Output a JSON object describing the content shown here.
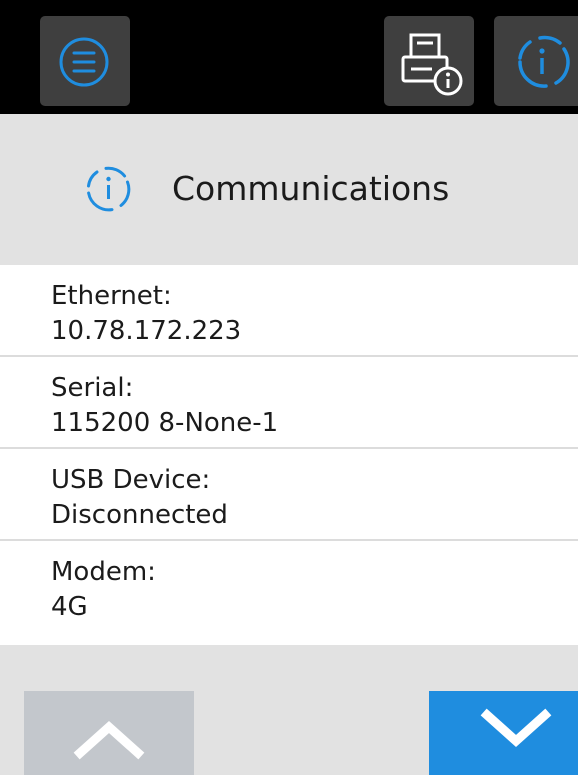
{
  "header": {
    "title": "Communications",
    "icon": "info-icon",
    "accent": "#1f8ddf"
  },
  "topbar": {
    "buttons": [
      {
        "name": "menu",
        "icon": "menu-icon"
      },
      {
        "name": "printer-info",
        "icon": "printer-info-icon"
      },
      {
        "name": "info",
        "icon": "info-icon",
        "active": true
      }
    ]
  },
  "items": [
    {
      "label": "Ethernet:",
      "value": "10.78.172.223"
    },
    {
      "label": "Serial:",
      "value": "115200 8-None-1"
    },
    {
      "label": "USB Device:",
      "value": "Disconnected"
    },
    {
      "label": "Modem:",
      "value": "4G"
    }
  ],
  "footer": {
    "up": {
      "icon": "chevron-up-icon",
      "enabled": false,
      "color": "#c3c7cc"
    },
    "down": {
      "icon": "chevron-down-icon",
      "enabled": true,
      "color": "#1f8ddf"
    }
  }
}
